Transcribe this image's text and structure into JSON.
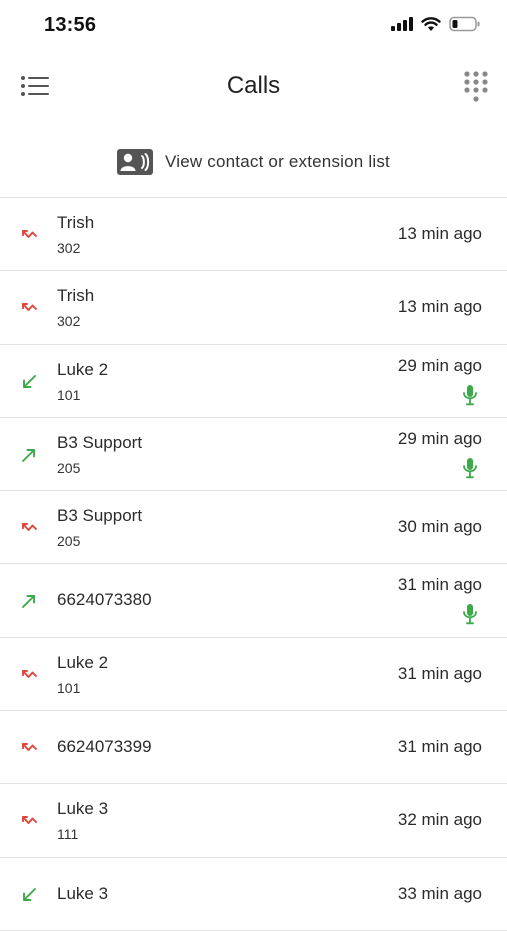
{
  "status_bar": {
    "time": "13:56",
    "icons": [
      "signal-icon",
      "wifi-icon",
      "battery-icon"
    ]
  },
  "header": {
    "title": "Calls",
    "menu_icon": "list-menu-icon",
    "dialpad_icon": "dialpad-icon"
  },
  "contact_link": {
    "label": "View contact or extension list",
    "icon": "contact-card-icon"
  },
  "colors": {
    "missed": "#e0453a",
    "answered": "#3daa4a",
    "icon_gray": "#555555"
  },
  "calls": [
    {
      "name": "Trish",
      "ext": "302",
      "time": "13 min ago",
      "type": "missed",
      "recording": false
    },
    {
      "name": "Trish",
      "ext": "302",
      "time": "13 min ago",
      "type": "missed",
      "recording": false
    },
    {
      "name": "Luke 2",
      "ext": "101",
      "time": "29 min ago",
      "type": "incoming",
      "recording": true
    },
    {
      "name": "B3 Support",
      "ext": "205",
      "time": "29 min ago",
      "type": "outgoing",
      "recording": true
    },
    {
      "name": "B3 Support",
      "ext": "205",
      "time": "30 min ago",
      "type": "missed",
      "recording": false
    },
    {
      "name": "6624073380",
      "ext": "",
      "time": "31 min ago",
      "type": "outgoing",
      "recording": true
    },
    {
      "name": "Luke 2",
      "ext": "101",
      "time": "31 min ago",
      "type": "missed",
      "recording": false
    },
    {
      "name": "6624073399",
      "ext": "",
      "time": "31 min ago",
      "type": "missed",
      "recording": false
    },
    {
      "name": "Luke 3",
      "ext": "111",
      "time": "32 min ago",
      "type": "missed",
      "recording": false
    },
    {
      "name": "Luke 3",
      "ext": "",
      "time": "33 min ago",
      "type": "incoming",
      "recording": false
    }
  ]
}
